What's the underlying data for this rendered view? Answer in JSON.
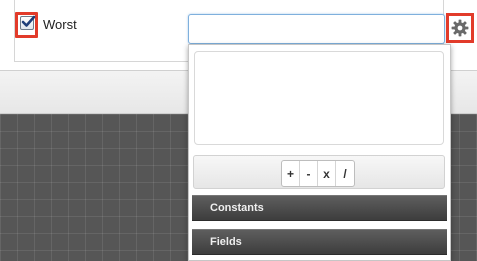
{
  "option": {
    "checkbox_label": "Worst",
    "checked": true
  },
  "expression": {
    "value": ""
  },
  "builder": {
    "formula_text": "",
    "operators": [
      "+",
      "-",
      "x",
      "/"
    ],
    "sections": [
      "Constants",
      "Fields"
    ]
  },
  "colors": {
    "highlight": "#e23b2a",
    "input_focus": "#7fb0dd",
    "grid_bg": "#565656",
    "section_bg": "#4a4a4a"
  },
  "icons": {
    "gear": "gear-icon",
    "check": "checkmark-icon"
  }
}
